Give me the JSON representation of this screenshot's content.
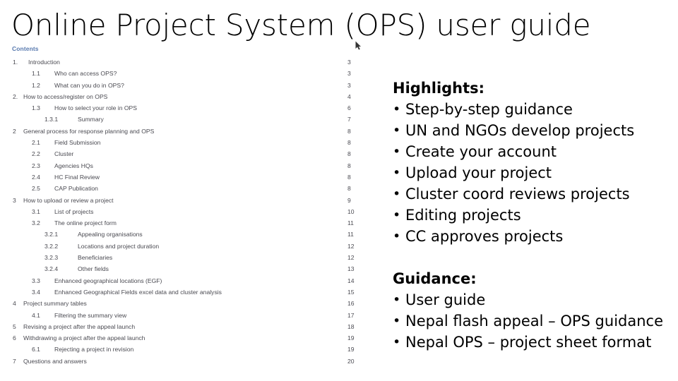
{
  "slide": {
    "title": "Online Project System (OPS) user guide"
  },
  "toc": {
    "heading": "Contents",
    "rows": [
      {
        "num": "1.",
        "text": "Introduction",
        "page": "3",
        "level": "lvl0"
      },
      {
        "num": "1.1",
        "text": "Who can access OPS?",
        "page": "3",
        "level": "lvl1"
      },
      {
        "num": "1.2",
        "text": "What can you do in OPS?",
        "page": "3",
        "level": "lvl1"
      },
      {
        "num": "2.",
        "text": "How to access/register on OPS",
        "page": "4",
        "level": "lvl0b"
      },
      {
        "num": "1.3",
        "text": "How to select your role in OPS",
        "page": "6",
        "level": "lvl1"
      },
      {
        "num": "1.3.1",
        "text": "Summary",
        "page": "7",
        "level": "lvl2"
      },
      {
        "num": "2",
        "text": "General process for response planning and OPS",
        "page": "8",
        "level": "lvl0b"
      },
      {
        "num": "2.1",
        "text": "Field Submission",
        "page": "8",
        "level": "lvl1"
      },
      {
        "num": "2.2",
        "text": "Cluster",
        "page": "8",
        "level": "lvl1"
      },
      {
        "num": "2.3",
        "text": "Agencies HQs",
        "page": "8",
        "level": "lvl1"
      },
      {
        "num": "2.4",
        "text": "HC Final Review",
        "page": "8",
        "level": "lvl1"
      },
      {
        "num": "2.5",
        "text": "CAP Publication",
        "page": "8",
        "level": "lvl1"
      },
      {
        "num": "3",
        "text": "How to upload or review a project",
        "page": "9",
        "level": "lvl0b"
      },
      {
        "num": "3.1",
        "text": "List of projects",
        "page": "10",
        "level": "lvl1"
      },
      {
        "num": "3.2",
        "text": "The online project form",
        "page": "11",
        "level": "lvl1"
      },
      {
        "num": "3.2.1",
        "text": "Appealing organisations",
        "page": "11",
        "level": "lvl2"
      },
      {
        "num": "3.2.2",
        "text": "Locations and project duration",
        "page": "12",
        "level": "lvl2"
      },
      {
        "num": "3.2.3",
        "text": "Beneficiaries",
        "page": "12",
        "level": "lvl2"
      },
      {
        "num": "3.2.4",
        "text": "Other fields",
        "page": "13",
        "level": "lvl2"
      },
      {
        "num": "3.3",
        "text": "Enhanced geographical locations (EGF)",
        "page": "14",
        "level": "lvl1"
      },
      {
        "num": "3.4",
        "text": "Enhanced Geographical Fields excel data and cluster analysis",
        "page": "15",
        "level": "lvl1"
      },
      {
        "num": "4",
        "text": "Project summary tables",
        "page": "16",
        "level": "lvl0b"
      },
      {
        "num": "4.1",
        "text": "Filtering the summary view",
        "page": "17",
        "level": "lvl1"
      },
      {
        "num": "5",
        "text": "Revising a project after the appeal launch",
        "page": "18",
        "level": "lvl0b"
      },
      {
        "num": "6",
        "text": "Withdrawing a project after the appeal launch",
        "page": "19",
        "level": "lvl0b"
      },
      {
        "num": "6.1",
        "text": "Rejecting a project in revision",
        "page": "19",
        "level": "lvl1"
      },
      {
        "num": "7",
        "text": "Questions and answers",
        "page": "20",
        "level": "lvl0b"
      }
    ]
  },
  "highlights": {
    "title": "Highlights:",
    "bullet_glyph": "•",
    "items": [
      "Step-by-step guidance",
      "UN and NGOs develop projects",
      "Create your account",
      "Upload your project",
      "Cluster coord reviews projects",
      "Editing projects",
      "CC approves projects"
    ]
  },
  "guidance": {
    "title": "Guidance:",
    "bullet_glyph": "•",
    "items": [
      "User guide",
      "Nepal flash appeal – OPS guidance",
      "Nepal OPS – project sheet format"
    ]
  },
  "colors": {
    "background": "#ffffff",
    "title_text": "#000000",
    "toc_heading": "#4a6ea8",
    "toc_text": "#3a3a42",
    "body_text": "#000000"
  }
}
